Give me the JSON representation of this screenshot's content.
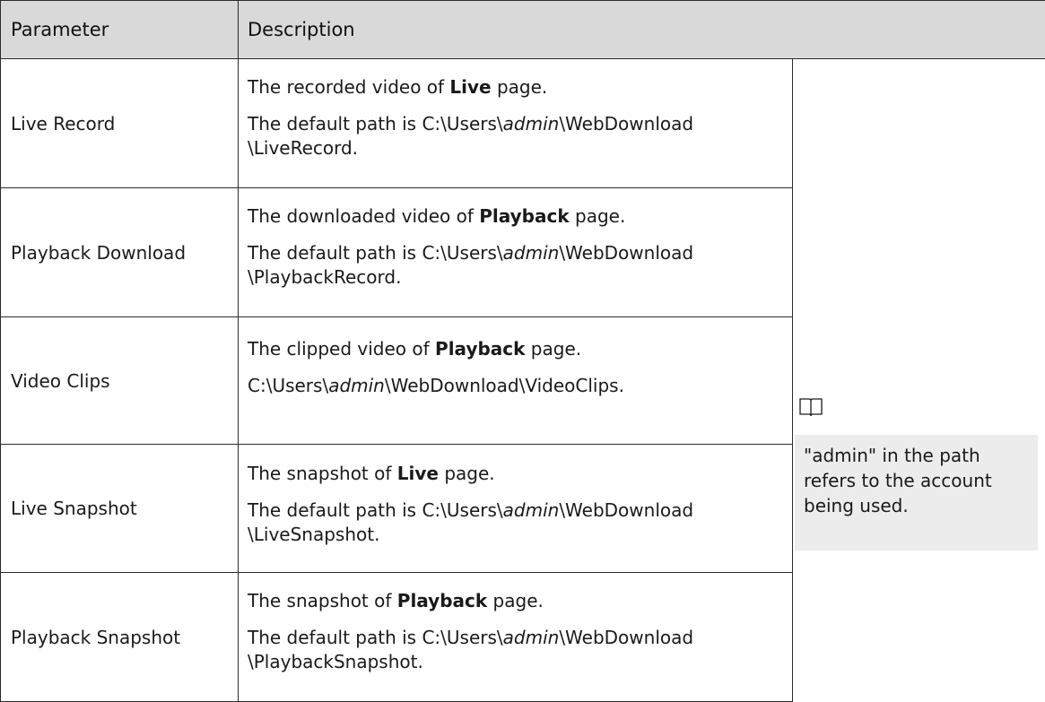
{
  "header": {
    "parameter": "Parameter",
    "description": "Description"
  },
  "rows": [
    {
      "parameter": "Live Record",
      "line1_pre": "The recorded video of ",
      "line1_bold": "Live",
      "line1_post": "  page.",
      "line2_pre": "The default path is C:\\Users\\",
      "line2_italic": "admin",
      "line2_post": "\\WebDownload",
      "line3": "\\LiveRecord."
    },
    {
      "parameter": "Playback Download",
      "line1_pre": "The downloaded video of ",
      "line1_bold": "Playback",
      "line1_post": "  page.",
      "line2_pre": "The default path is C:\\Users\\",
      "line2_italic": "admin",
      "line2_post": "\\WebDownload",
      "line3": "\\PlaybackRecord."
    },
    {
      "parameter": "Video Clips",
      "line1_pre": "The clipped video of ",
      "line1_bold": "Playback",
      "line1_post": "  page.",
      "line2_pre": "C:\\Users\\",
      "line2_italic": "admin",
      "line2_post": "\\WebDownload\\VideoClips.",
      "line3": ""
    },
    {
      "parameter": "Live Snapshot",
      "line1_pre": "The snapshot of ",
      "line1_bold": "Live",
      "line1_post": "  page.",
      "line2_pre": "The default path is C:\\Users\\",
      "line2_italic": "admin",
      "line2_post": "\\WebDownload",
      "line3": "\\LiveSnapshot."
    },
    {
      "parameter": "Playback Snapshot",
      "line1_pre": "The snapshot of ",
      "line1_bold": "Playback",
      "line1_post": "  page.",
      "line2_pre": "The default path is C:\\Users\\",
      "line2_italic": "admin",
      "line2_post": "\\WebDownload",
      "line3": "\\PlaybackSnapshot."
    }
  ],
  "note": {
    "icon": "book-icon",
    "text": "\"admin\" in the path refers to the account being used."
  }
}
